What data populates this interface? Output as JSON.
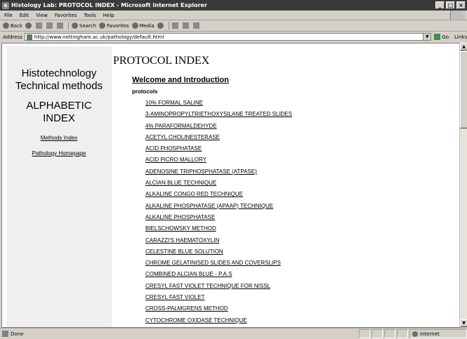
{
  "window": {
    "title": "Histology Lab: PROTOCOL INDEX - Microsoft Internet Explorer",
    "controls": {
      "minimize": "_",
      "maximize": "□",
      "close": "×"
    }
  },
  "menu": [
    "File",
    "Edit",
    "View",
    "Favorites",
    "Tools",
    "Help"
  ],
  "toolbar": {
    "back": "Back",
    "search": "Search",
    "favorites": "Favorites",
    "media": "Media"
  },
  "address": {
    "label": "Address",
    "url": "http://www.nottingham.ac.uk/pathology/default.html",
    "go": "Go",
    "links": "Links"
  },
  "sidebar": {
    "heading1": "Histotechnology Technical methods",
    "heading2": "ALPHABETIC INDEX",
    "links": [
      "Methods Index",
      "Pathology Homepage"
    ]
  },
  "main": {
    "title": "PROTOCOL INDEX",
    "welcome": "Welcome and Introduction",
    "protocols_label": "protocols",
    "protocols": [
      "10% FORMAL SALINE",
      "3-AMINOPROPYLTRIETHOXYSILANE TREATED SLIDES",
      "4% PARAFORMALDEHYDE",
      "ACETYL CHOLINESTERASE",
      "ACID PHOSPHATASE",
      "ACID PICRO MALLORY",
      "ADENOSINE TRIPHOSPHATASE (ATPASE)",
      "ALCIAN BLUE TECHNIQUE",
      "ALKALINE CONGO RED TECHNIQUE",
      "ALKALINE PHOSPHATASE (APAAP) TECHNIQUE",
      "ALKALINE PHOSPHATASE",
      "BIELSCHOWSKY METHOD",
      "CARAZZI'S HAEMATOXYLIN",
      "CELESTINE BLUE SOLUTION",
      "CHROME GELATINISED SLIDES AND COVERSLIPS",
      "COMBINED ALCIAN BLUE - P.A.S",
      "CRESYL FAST VIOLET TECHNIQUE FOR NISSL",
      "CRESYL FAST VIOLET",
      "CROSS-PALMGRENS METHOD",
      "CYTOCHROME OXIDASE TECHNIQUE"
    ]
  },
  "status": {
    "text": "Done",
    "zone": "Internet"
  }
}
